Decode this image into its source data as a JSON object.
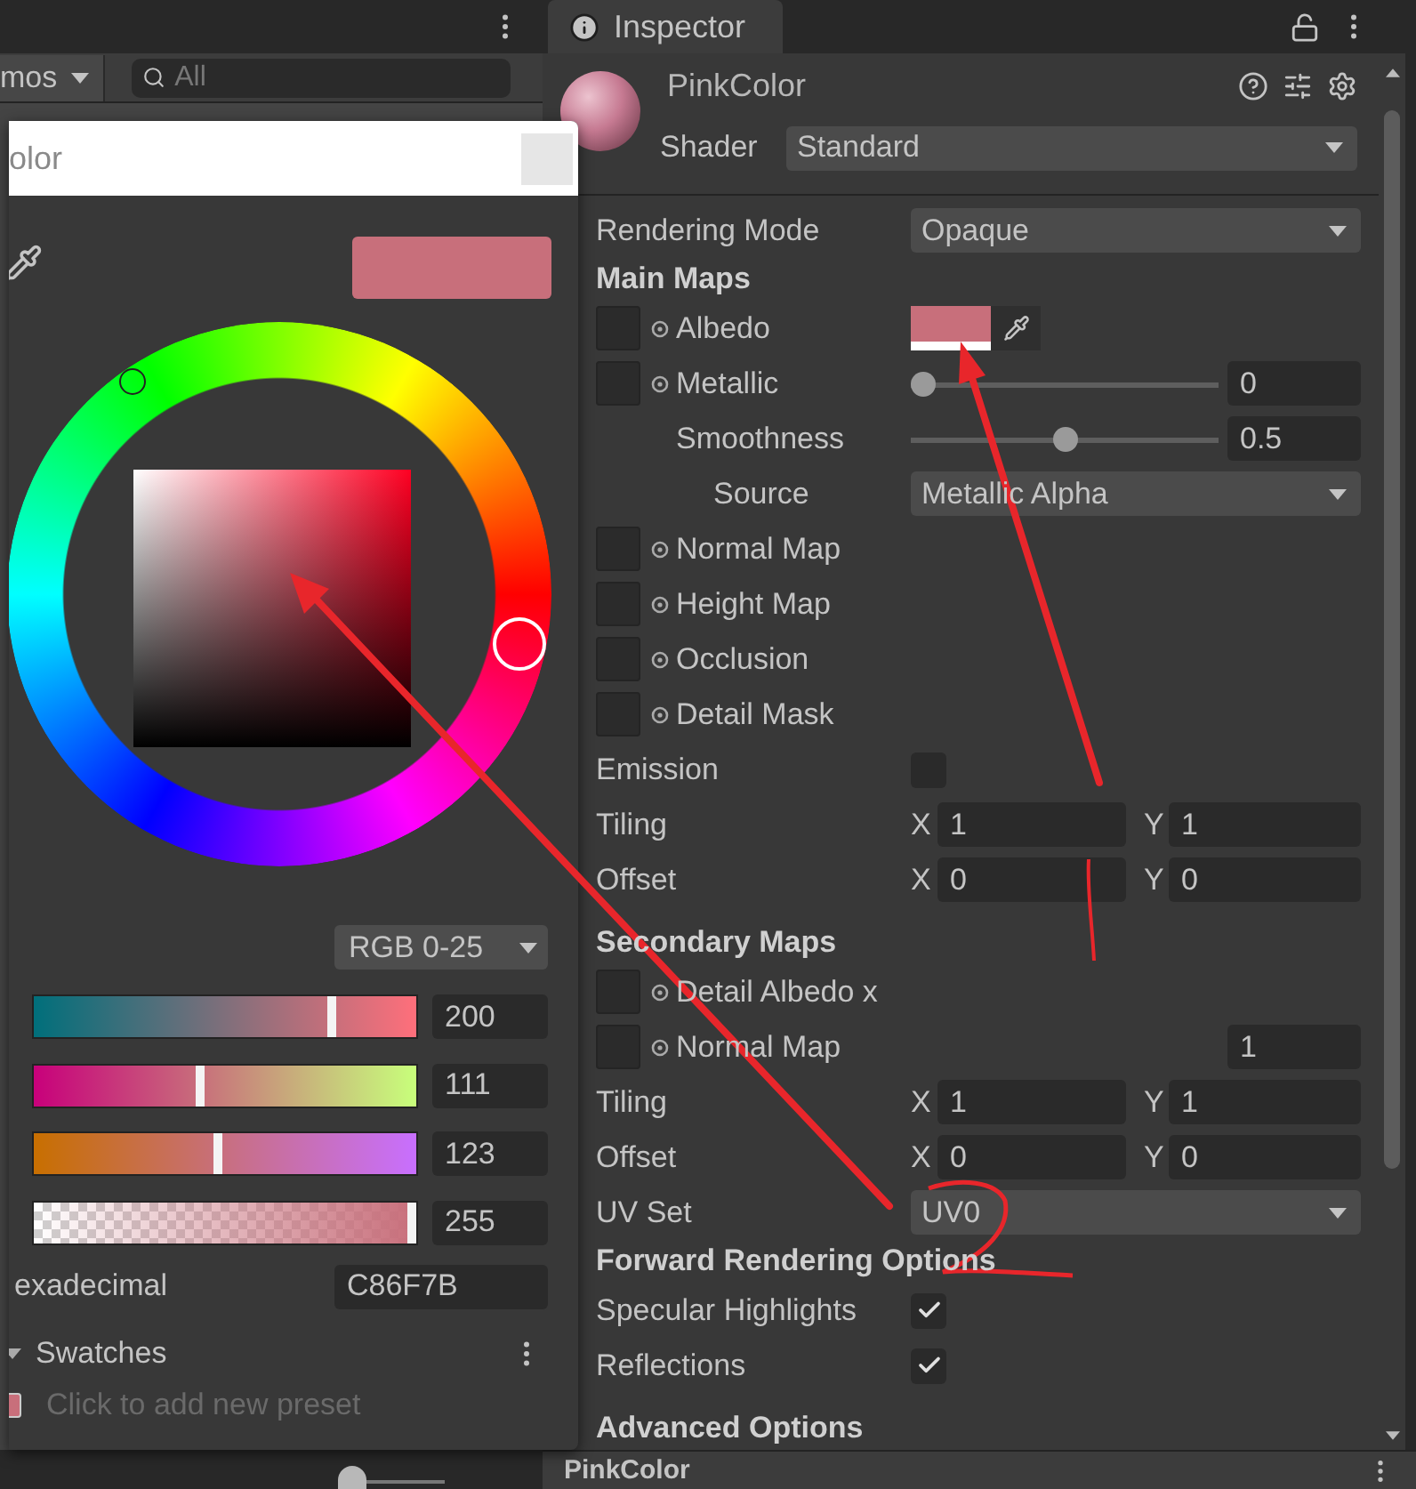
{
  "left_panel": {
    "toolbar": {
      "gizmos_button": "mos",
      "search": {
        "placeholder": "All"
      }
    },
    "bottom_bar": {
      "zoom_slider": {
        "level": 0
      }
    }
  },
  "color_picker": {
    "title": "olor",
    "color": "#c86f7b",
    "mode": "RGB 0-25",
    "channels": [
      {
        "value": "200",
        "level": 0.784
      },
      {
        "value": "111",
        "level": 0.435
      },
      {
        "value": "123",
        "level": 0.482
      },
      {
        "value": "255",
        "level": 1
      }
    ],
    "hex_label": "exadecimal",
    "hex_value": "C86F7B",
    "swatches": {
      "label": "Swatches",
      "expanded": true,
      "presets": [
        {
          "color": "#c86f7b"
        }
      ],
      "hint": "Click to add new preset"
    }
  },
  "inspector": {
    "tab": "Inspector",
    "material": "PinkColor",
    "shader_label": "Shader",
    "shader": "Standard",
    "properties": [
      {
        "kind": "dropdown",
        "label": "Rendering Mode",
        "value": "Opaque"
      },
      {
        "kind": "header",
        "label": "Main Maps"
      },
      {
        "kind": "color",
        "label": "Albedo",
        "color": "#c86f7b"
      },
      {
        "kind": "texture_slider",
        "label": "Metallic",
        "level": 0,
        "value": "0",
        "children": [
          {
            "kind": "slider",
            "label": "Smoothness",
            "level": 0.5,
            "value": "0.5",
            "children": [
              {
                "kind": "dropdown",
                "label": "Source",
                "value": "Metallic Alpha"
              }
            ]
          }
        ]
      },
      {
        "kind": "texture",
        "label": "Normal Map"
      },
      {
        "kind": "texture",
        "label": "Height Map"
      },
      {
        "kind": "texture",
        "label": "Occlusion"
      },
      {
        "kind": "texture",
        "label": "Detail Mask"
      },
      {
        "kind": "checkbox",
        "label": "Emission",
        "checked": false
      },
      {
        "kind": "vector2",
        "label": "Tiling",
        "x": {
          "label": "X",
          "value": "1"
        },
        "y": {
          "label": "Y",
          "value": "1"
        }
      },
      {
        "kind": "vector2",
        "label": "Offset",
        "x": {
          "label": "X",
          "value": "0"
        },
        "y": {
          "label": "Y",
          "value": "0"
        }
      },
      {
        "kind": "header",
        "label": "Secondary Maps"
      },
      {
        "kind": "texture",
        "label": "Detail Albedo x"
      },
      {
        "kind": "texture_float",
        "label": "Normal Map",
        "value": "1"
      },
      {
        "kind": "vector2",
        "label": "Tiling",
        "x": {
          "label": "X",
          "value": "1"
        },
        "y": {
          "label": "Y",
          "value": "1"
        }
      },
      {
        "kind": "vector2",
        "label": "Offset",
        "x": {
          "label": "X",
          "value": "0"
        },
        "y": {
          "label": "Y",
          "value": "0"
        }
      },
      {
        "kind": "dropdown",
        "label": "UV Set",
        "value": "UV0"
      },
      {
        "kind": "header",
        "label": "Forward Rendering Options"
      },
      {
        "kind": "checkbox",
        "label": "Specular Highlights",
        "checked": true
      },
      {
        "kind": "checkbox",
        "label": "Reflections",
        "checked": true
      },
      {
        "kind": "header",
        "label": "Advanced Options"
      }
    ],
    "footer": "PinkColor"
  }
}
